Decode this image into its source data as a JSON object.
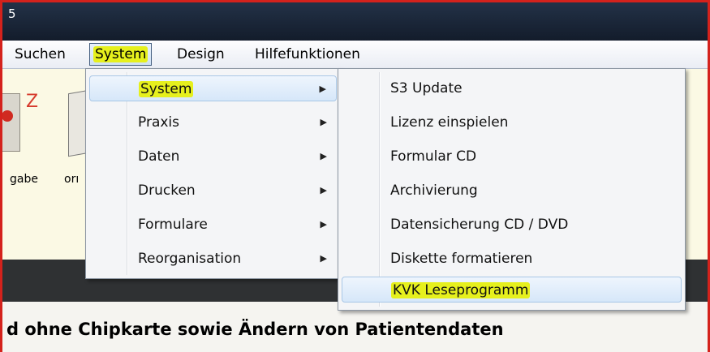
{
  "window": {
    "title_fragment": "5"
  },
  "menubar": {
    "items": [
      {
        "label": "Suchen",
        "active": false
      },
      {
        "label": "System",
        "active": true
      },
      {
        "label": "Design",
        "active": false
      },
      {
        "label": "Hilfefunktionen",
        "active": false
      }
    ]
  },
  "toolbar": {
    "icon_letter": "Z",
    "labels": [
      "gabe",
      "orı"
    ]
  },
  "menu_system": {
    "items": [
      {
        "label": "System",
        "has_submenu": true,
        "selected": true
      },
      {
        "label": "Praxis",
        "has_submenu": true
      },
      {
        "label": "Daten",
        "has_submenu": true
      },
      {
        "label": "Drucken",
        "has_submenu": true
      },
      {
        "label": "Formulare",
        "has_submenu": true
      },
      {
        "label": "Reorganisation",
        "has_submenu": true
      }
    ]
  },
  "submenu_system": {
    "items": [
      {
        "label": "S3 Update"
      },
      {
        "label": "Lizenz einspielen"
      },
      {
        "label": "Formular CD"
      },
      {
        "label": "Archivierung"
      },
      {
        "label": "Datensicherung CD / DVD"
      },
      {
        "label": "Diskette formatieren"
      },
      {
        "label": "KVK Leseprogramm",
        "selected": true
      }
    ]
  },
  "status": {
    "text": "d ohne Chipkarte sowie Ändern von Patientendaten"
  },
  "colors": {
    "highlight": "#e6f01d",
    "frame": "#d4221c",
    "titlebar": "#1a2536"
  }
}
